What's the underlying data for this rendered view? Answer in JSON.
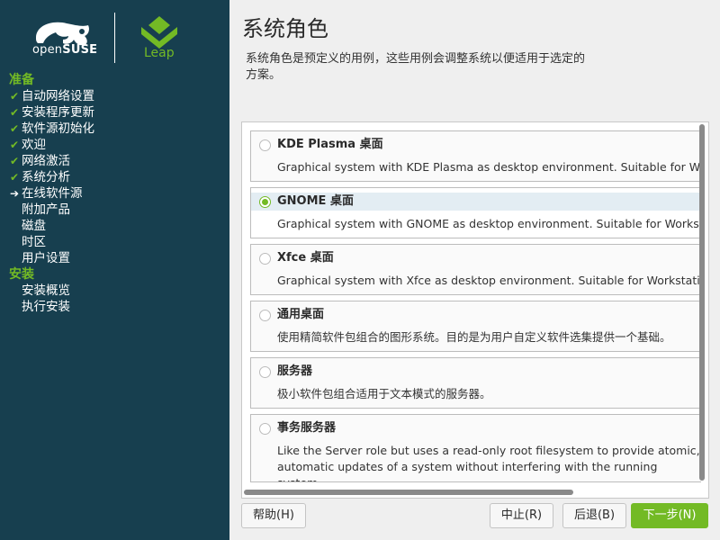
{
  "branding": {
    "brand_prefix": "open",
    "brand_name": "SUSE",
    "product": "Leap"
  },
  "steps": [
    {
      "type": "header",
      "label": "准备"
    },
    {
      "type": "step",
      "label": "自动网络设置",
      "state": "done"
    },
    {
      "type": "step",
      "label": "安装程序更新",
      "state": "done"
    },
    {
      "type": "step",
      "label": "软件源初始化",
      "state": "done"
    },
    {
      "type": "step",
      "label": "欢迎",
      "state": "done"
    },
    {
      "type": "step",
      "label": "网络激活",
      "state": "done"
    },
    {
      "type": "step",
      "label": "系统分析",
      "state": "done"
    },
    {
      "type": "step",
      "label": "在线软件源",
      "state": "current"
    },
    {
      "type": "step",
      "label": "附加产品",
      "state": "pending"
    },
    {
      "type": "step",
      "label": "磁盘",
      "state": "pending"
    },
    {
      "type": "step",
      "label": "时区",
      "state": "pending"
    },
    {
      "type": "step",
      "label": "用户设置",
      "state": "pending"
    },
    {
      "type": "header",
      "label": "安装"
    },
    {
      "type": "step",
      "label": "安装概览",
      "state": "pending"
    },
    {
      "type": "step",
      "label": "执行安装",
      "state": "pending"
    }
  ],
  "main": {
    "title": "系统角色",
    "description": "系统角色是预定义的用例，这些用例会调整系统以便适用于选定的方案。"
  },
  "roles": [
    {
      "title": "KDE Plasma 桌面",
      "description": "Graphical system with KDE Plasma as desktop environment. Suitable for Workstations, Desktops and Laptops.",
      "selected": false
    },
    {
      "title": "GNOME 桌面",
      "description": "Graphical system with GNOME as desktop environment. Suitable for Workstations, Desktops and Laptops.",
      "selected": true
    },
    {
      "title": "Xfce 桌面",
      "description": "Graphical system with Xfce as desktop environment. Suitable for Workstations, Desktops and Laptops.",
      "selected": false
    },
    {
      "title": "通用桌面",
      "description": "使用精简软件包组合的图形系统。目的是为用户自定义软件选集提供一个基础。",
      "selected": false
    },
    {
      "title": "服务器",
      "description": "极小软件包组合适用于文本模式的服务器。",
      "selected": false
    },
    {
      "title": "事务服务器",
      "description": "Like the Server role but uses a read-only root filesystem to provide atomic, automatic updates of a system without interfering with the running system.",
      "selected": false
    }
  ],
  "buttons": {
    "help": "帮助(H)",
    "abort": "中止(R)",
    "back": "后退(B)",
    "next": "下一步(N)"
  },
  "colors": {
    "sidebar_bg": "#173f4f",
    "accent_green": "#73ba25",
    "selected_row": "#e3edf3"
  },
  "icons": {
    "done_step": "check-icon",
    "current_step": "arrow-right-icon",
    "radio": "radio-icon"
  }
}
